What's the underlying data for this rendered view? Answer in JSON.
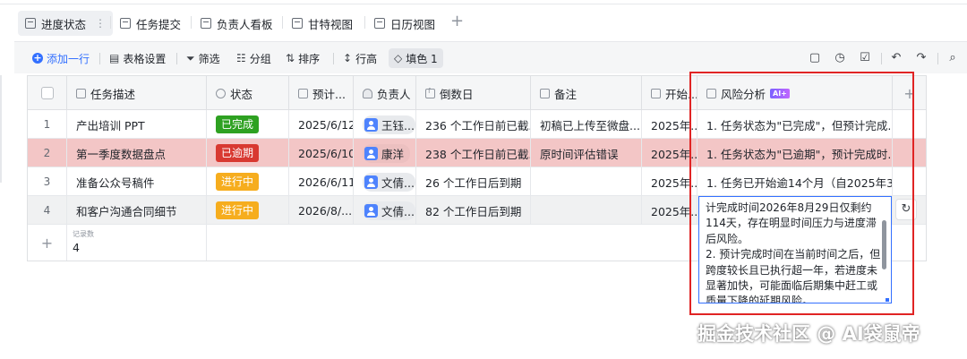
{
  "view_tabs": [
    {
      "label": "进度状态",
      "more": "⋮"
    },
    {
      "label": "任务提交"
    },
    {
      "label": "负责人看板"
    },
    {
      "label": "甘特视图"
    },
    {
      "label": "日历视图"
    }
  ],
  "add_view": "+",
  "toolbar": {
    "add_row": "添加一行",
    "table_settings": "表格设置",
    "filter": "筛选",
    "group": "分组",
    "sort": "排序",
    "row_height": "行高",
    "fill_color": "填色 1"
  },
  "columns": [
    {
      "label": "任务描述"
    },
    {
      "label": "状态"
    },
    {
      "label": "预计..."
    },
    {
      "label": "负责人"
    },
    {
      "label": "倒数日"
    },
    {
      "label": "备注"
    },
    {
      "label": "开始..."
    },
    {
      "label": "风险分析",
      "badge": "AI+"
    }
  ],
  "rows": [
    {
      "num": "1",
      "task": "产出培训 PPT",
      "status": "已完成",
      "due": "2025/6/12",
      "owner": "王钰...",
      "countdown": "236 个工作日前已截...",
      "note": "初稿已上传至微盘...",
      "start": "2025年...",
      "risk": "1. 任务状态为\"已完成\"，但预计完成..."
    },
    {
      "num": "2",
      "task": "第一季度数据盘点",
      "status": "已逾期",
      "due": "2025/6/10",
      "owner": "康洋",
      "countdown": "238 个工作日前已截...",
      "note": "原时间评估错误",
      "start": "2025年...",
      "risk": "1. 任务状态为\"已逾期\"，预计完成时..."
    },
    {
      "num": "3",
      "task": "准备公众号稿件",
      "status": "进行中",
      "due": "2026/6/11",
      "owner": "文倩...",
      "countdown": "26 个工作日后到期",
      "note": "",
      "start": "2025年...",
      "risk": "1. 任务已开始逾14个月（自2025年3..."
    },
    {
      "num": "4",
      "task": "和客户沟通合同细节",
      "status": "进行中",
      "due": "2026/8/...",
      "owner": "文倩...",
      "countdown": "82 个工作日后到期",
      "note": "",
      "start": "2025年...",
      "risk": ""
    }
  ],
  "footer": {
    "count_label": "记录数",
    "count": "4",
    "add": "+"
  },
  "expanded_risk_text": "计完成时间2026年8月29日仅剩约114天，存在明显时间压力与进度滞后风险。\n2. 预计完成时间在当前时间之后，但跨度较长且已执行超一年，若进度未显著加快，可能面临后期集中赶工或质量下降的延期风险。",
  "watermark": "掘金技术社区 @ AI袋鼠帝",
  "colors": {
    "accent": "#3370ff",
    "done": "#2ea121",
    "overdue": "#d83931",
    "in_progress": "#f6ad1e",
    "overdue_row": "#f3c6c6",
    "highlight_box": "#e02424"
  }
}
